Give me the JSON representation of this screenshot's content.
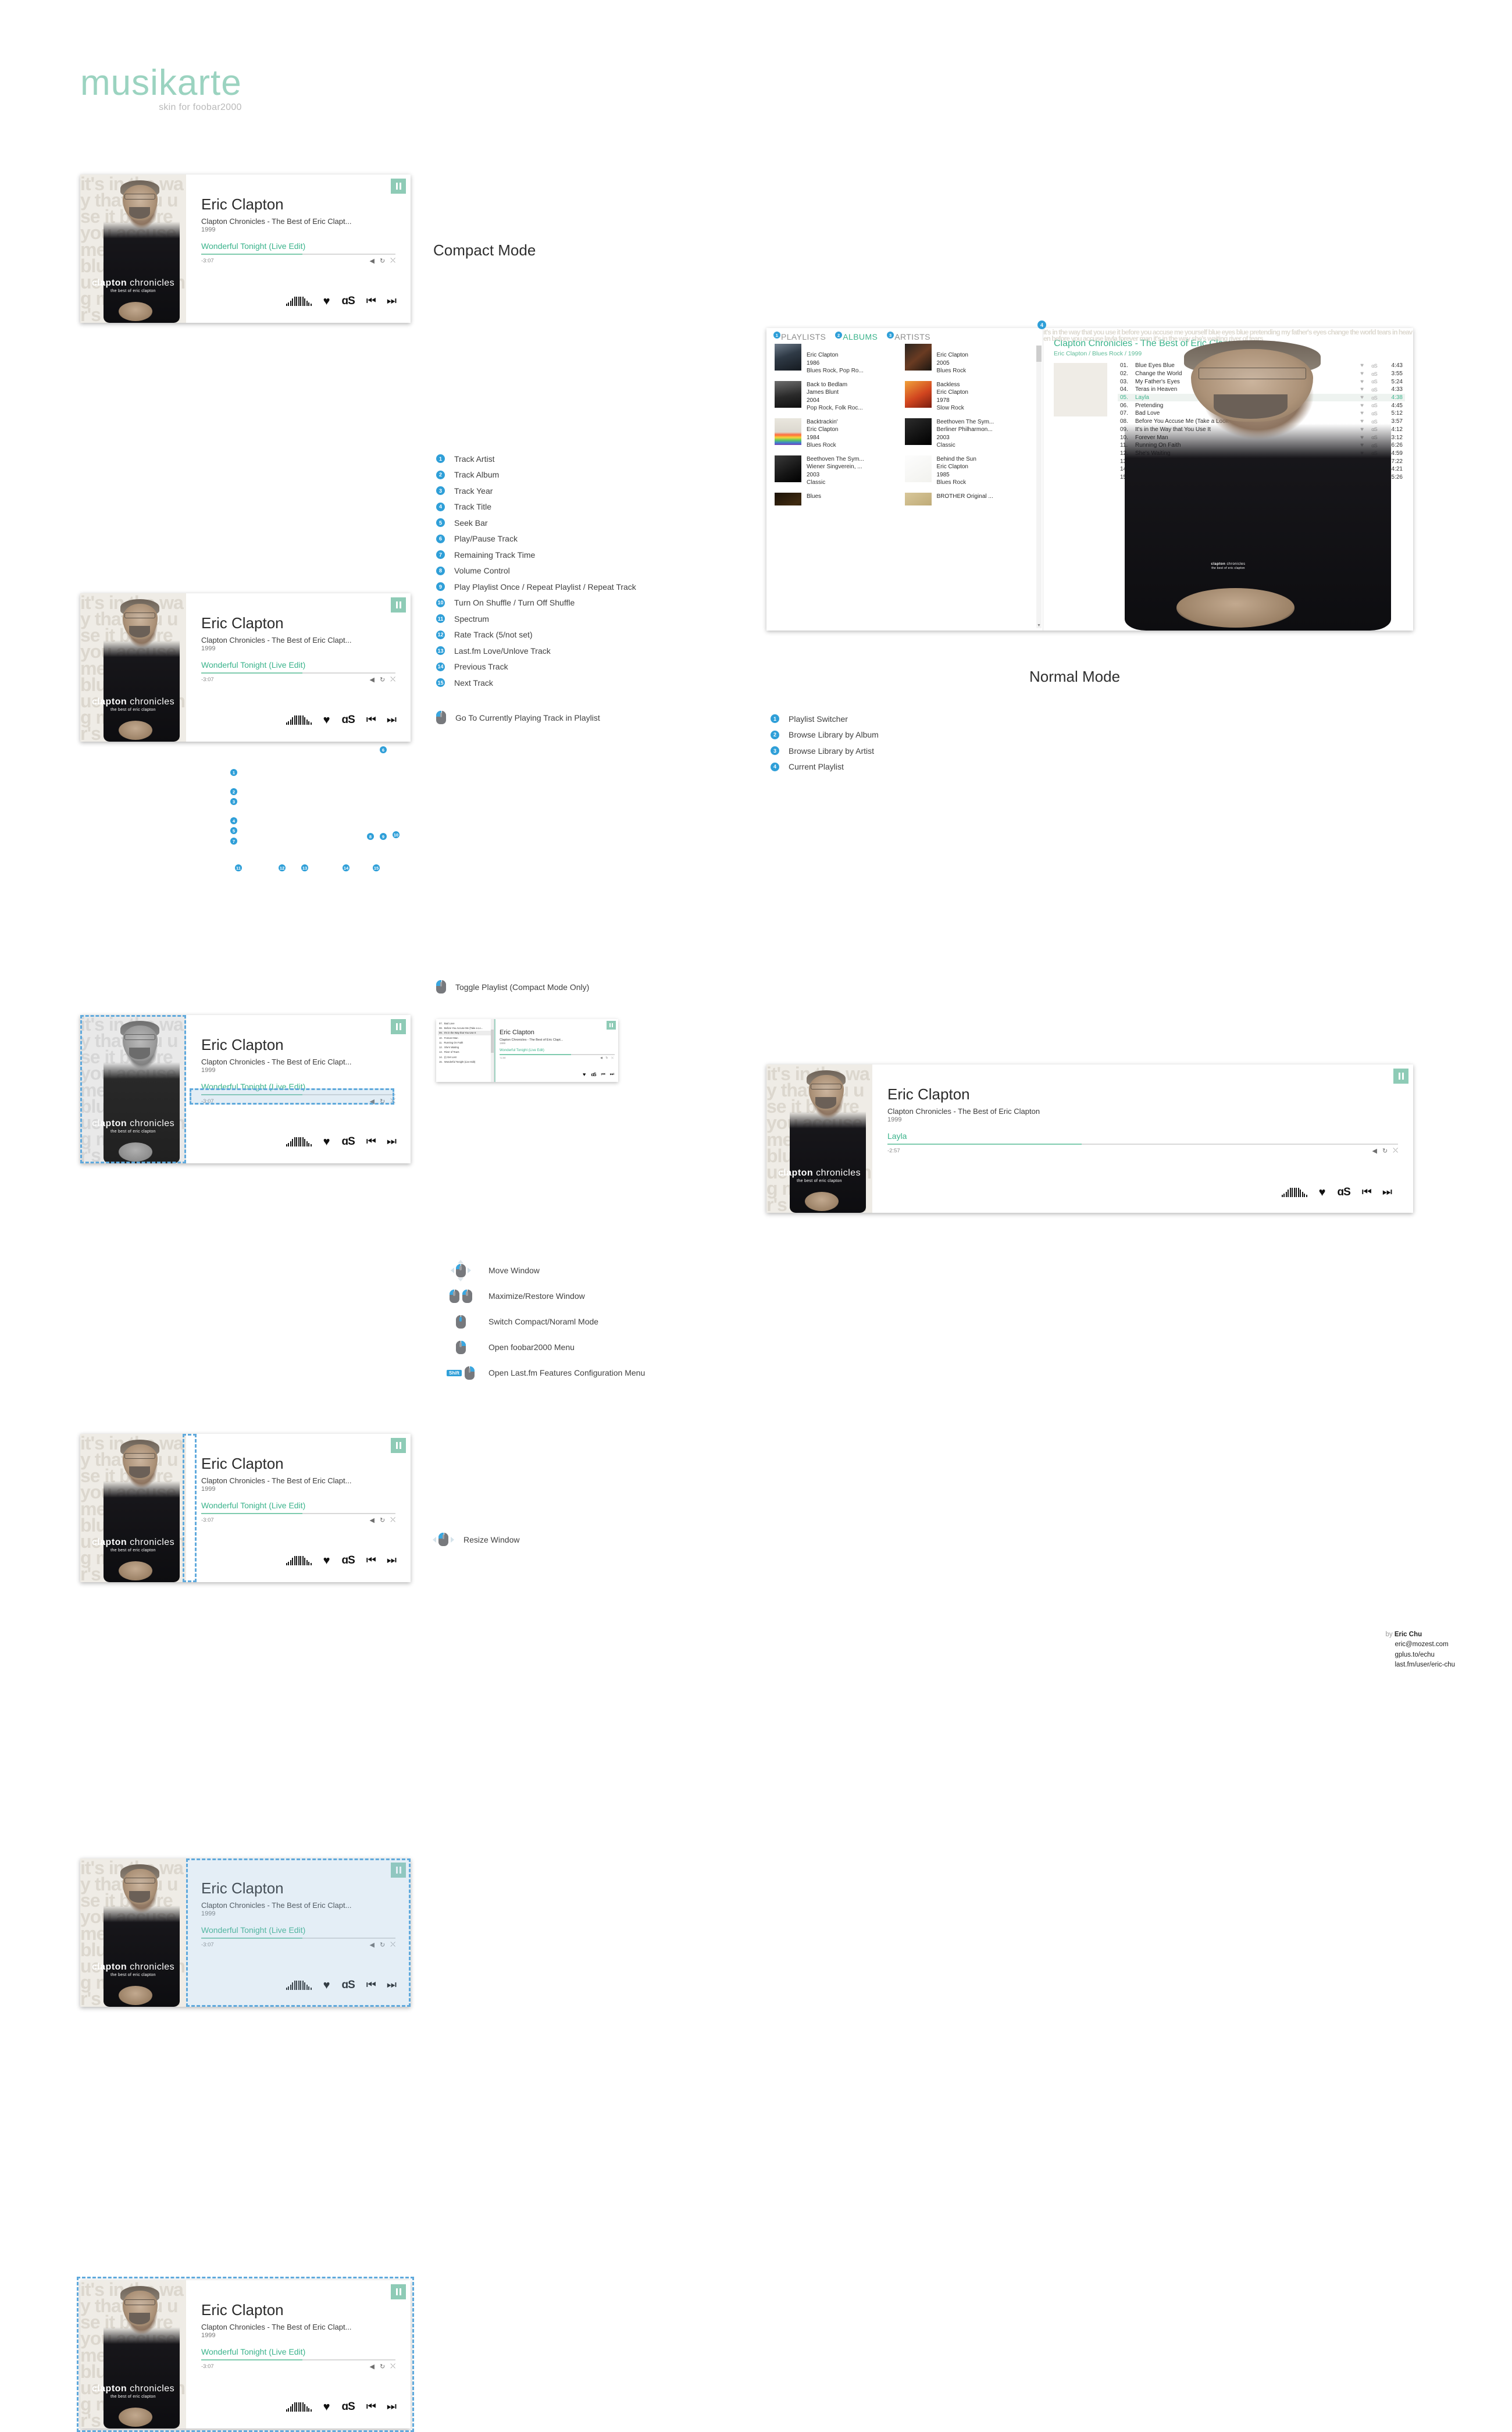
{
  "logo": {
    "word": "musikarte",
    "subtitle": "skin for foobar2000"
  },
  "mode_labels": {
    "compact": "Compact Mode",
    "normal": "Normal Mode"
  },
  "player": {
    "artist": "Eric Clapton",
    "album": "Clapton Chronicles - The Best of Eric Clapt...",
    "album_full": "Clapton Chronicles - The Best of Eric Clapton",
    "year": "1999",
    "title": "Wonderful Tonight (Live Edit)",
    "title_normal": "Layla",
    "remaining": "-3:07",
    "remaining_normal": "-2:57",
    "remaining_mini": "-1:34",
    "cover_line1_bold": "clapton",
    "cover_line1_rest": " chronicles",
    "cover_line2": "the best of eric clapton",
    "cover_bg_text": "it's in the way that you use it before you accuse me yourself blue eyes blue pretending my father's eyes change the world tears in heaven before you accuse layla forever man it's in the way she's waiting river of tears",
    "mini_icons": [
      "volume-icon",
      "repeat-icon",
      "shuffle-icon"
    ],
    "transport_icons": [
      "spectrum",
      "heart",
      "lastfm",
      "previous",
      "next"
    ],
    "accent": "#3ab38b",
    "pause_accent": "#8ecbb6",
    "callout_color": "#2f9fd8"
  },
  "compact_legend": [
    {
      "n": "1",
      "label": "Track Artist"
    },
    {
      "n": "2",
      "label": "Track Album"
    },
    {
      "n": "3",
      "label": "Track Year"
    },
    {
      "n": "4",
      "label": "Track Title"
    },
    {
      "n": "5",
      "label": "Seek Bar"
    },
    {
      "n": "6",
      "label": "Play/Pause Track"
    },
    {
      "n": "7",
      "label": "Remaining Track Time"
    },
    {
      "n": "8",
      "label": "Volume Control"
    },
    {
      "n": "9",
      "label": "Play Playlist Once / Repeat Playlist / Repeat Track"
    },
    {
      "n": "10",
      "label": "Turn On Shuffle / Turn Off Shuffle"
    },
    {
      "n": "11",
      "label": "Spectrum"
    },
    {
      "n": "12",
      "label": "Rate Track (5/not set)"
    },
    {
      "n": "13",
      "label": "Last.fm Love/Unlove Track"
    },
    {
      "n": "14",
      "label": "Previous Track"
    },
    {
      "n": "15",
      "label": "Next Track"
    }
  ],
  "normal_legend": [
    {
      "n": "1",
      "label": "Playlist Switcher"
    },
    {
      "n": "2",
      "label": "Browse Library by Album"
    },
    {
      "n": "3",
      "label": "Browse Library by Artist"
    },
    {
      "n": "4",
      "label": "Current Playlist"
    }
  ],
  "mouse_legend": {
    "goto": "Go To Currently Playing Track in Playlist",
    "toggle_playlist": "Toggle Playlist (Compact Mode Only)",
    "move_window": "Move Window",
    "maximize_restore": "Maximize/Restore Window",
    "switch_mode": "Switch Compact/Noraml Mode",
    "open_foobar_menu": "Open foobar2000 Menu",
    "open_lastfm_menu": "Open Last.fm Features Configuration Menu",
    "shift_key": "Shift",
    "resize_window": "Resize Window"
  },
  "library": {
    "tabs": [
      {
        "n": "1",
        "label": "PLAYLISTS",
        "active": false
      },
      {
        "n": "2",
        "label": "ALBUMS",
        "active": true
      },
      {
        "n": "3",
        "label": "ARTISTS",
        "active": false
      }
    ],
    "current_playlist_callout": "4",
    "albums": [
      {
        "title": "",
        "artist": "Eric Clapton",
        "year": "1986",
        "genre": "Blues Rock, Pop Ro...",
        "cover": "c1"
      },
      {
        "title": "",
        "artist": "Eric Clapton",
        "year": "2005",
        "genre": "Blues Rock",
        "cover": "c2"
      },
      {
        "title": "Back to Bedlam",
        "artist": "James Blunt",
        "year": "2004",
        "genre": "Pop Rock, Folk Roc...",
        "cover": "c3"
      },
      {
        "title": "Backless",
        "artist": "Eric Clapton",
        "year": "1978",
        "genre": "Slow Rock",
        "cover": "c4"
      },
      {
        "title": "Backtrackin'",
        "artist": "Eric Clapton",
        "year": "1984",
        "genre": "Blues Rock",
        "cover": "c5"
      },
      {
        "title": "Beethoven The Sym...",
        "artist": "Berliner Philharmon...",
        "year": "2003",
        "genre": "Classic",
        "cover": "c6"
      },
      {
        "title": "Beethoven The Sym...",
        "artist": "Wiener Singverein, ...",
        "year": "2003",
        "genre": "Classic",
        "cover": "c7"
      },
      {
        "title": "Behind the Sun",
        "artist": "Eric Clapton",
        "year": "1985",
        "genre": "Blues Rock",
        "cover": "c8"
      },
      {
        "title": "Blues",
        "artist": "",
        "year": "",
        "genre": "",
        "cover": "c9"
      },
      {
        "title": "BROTHER Original ...",
        "artist": "",
        "year": "",
        "genre": "",
        "cover": "c10"
      }
    ]
  },
  "playlist": {
    "header": "Clapton Chronicles - The Best of Eric Clapton",
    "subheader": "Eric Clapton / Blues Rock / 1999",
    "love_icon": "heart-icon",
    "lastfm_icon": "lastfm-icon",
    "tracks": [
      {
        "n": "01.",
        "name": "Blue Eyes Blue",
        "dur": "4:43",
        "playing": false
      },
      {
        "n": "02.",
        "name": "Change the World",
        "dur": "3:55",
        "playing": false
      },
      {
        "n": "03.",
        "name": "My Father's Eyes",
        "dur": "5:24",
        "playing": false
      },
      {
        "n": "04.",
        "name": "Teras in Heaven",
        "dur": "4:33",
        "playing": false
      },
      {
        "n": "05.",
        "name": "Layla",
        "dur": "4:38",
        "playing": true
      },
      {
        "n": "06.",
        "name": "Pretending",
        "dur": "4:45",
        "playing": false
      },
      {
        "n": "07.",
        "name": "Bad Love",
        "dur": "5:12",
        "playing": false
      },
      {
        "n": "08.",
        "name": "Before You Accuse Me (Take a Look at Yourself)",
        "dur": "3:57",
        "playing": false
      },
      {
        "n": "09.",
        "name": "It's in the Way that You Use It",
        "dur": "4:12",
        "playing": false
      },
      {
        "n": "10.",
        "name": "Forever Man",
        "dur": "3:12",
        "playing": false
      },
      {
        "n": "11.",
        "name": "Running On Faith",
        "dur": "6:26",
        "playing": false
      },
      {
        "n": "12.",
        "name": "She's Waiting",
        "dur": "4:59",
        "playing": false
      },
      {
        "n": "13.",
        "name": "River of Tears",
        "dur": "7:22",
        "playing": false
      },
      {
        "n": "14.",
        "name": "(I) Get Lost",
        "dur": "4:21",
        "playing": false
      },
      {
        "n": "15.",
        "name": "Wonderful Tonight (Live Edit)",
        "dur": "5:26",
        "playing": false
      }
    ]
  },
  "mini_playlist": [
    {
      "n": "07.",
      "name": "Bad Love",
      "sel": false
    },
    {
      "n": "08.",
      "name": "Before You Accuse Me (Take a Lo...",
      "sel": false
    },
    {
      "n": "09.",
      "name": "It's in the Way that You Use It",
      "sel": true
    },
    {
      "n": "10.",
      "name": "Forever Man",
      "sel": false
    },
    {
      "n": "11.",
      "name": "Running On Faith",
      "sel": false
    },
    {
      "n": "12.",
      "name": "She's Waiting",
      "sel": false
    },
    {
      "n": "13.",
      "name": "River of Tears",
      "sel": false
    },
    {
      "n": "14.",
      "name": "(I) Get Lost",
      "sel": false
    },
    {
      "n": "15.",
      "name": "Wonderful Tonight (Live Edit)",
      "sel": false
    }
  ],
  "credit": {
    "by": "by",
    "name": "Eric Chu",
    "email": "eric@mozest.com",
    "gplus": "gplus.to/echu",
    "lastfm": "last.fm/user/eric-chu"
  }
}
